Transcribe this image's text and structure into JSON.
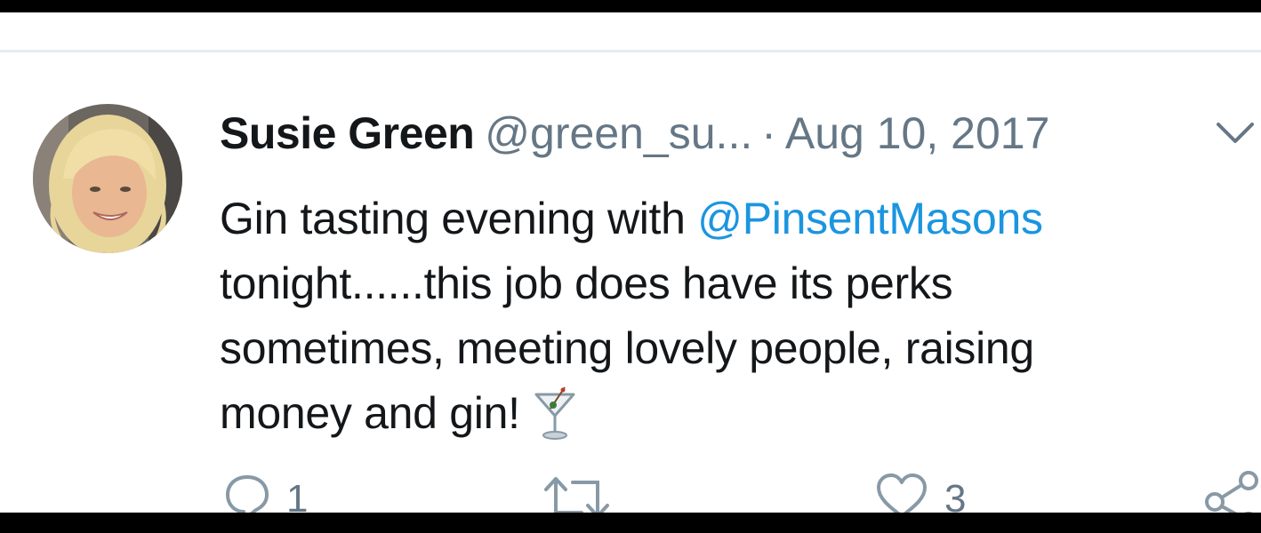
{
  "tweet": {
    "author_name": "Susie Green",
    "handle": "@green_su...",
    "separator": "·",
    "date": "Aug 10, 2017",
    "text_line1_pre": "Gin tasting evening with ",
    "mention": "@PinsentMasons",
    "text_line2": "tonight......this job does have its perks",
    "text_line3": "sometimes, meeting lovely people, raising",
    "text_line4": "money and gin!",
    "emoji": "cocktail-glass-icon"
  },
  "actions": {
    "reply_count": "1",
    "retweet_count": "",
    "like_count": "3"
  },
  "colors": {
    "text": "#14171a",
    "secondary": "#657786",
    "link": "#1b95e0",
    "divider": "#e6ecf0",
    "letterbox": "#000000"
  }
}
